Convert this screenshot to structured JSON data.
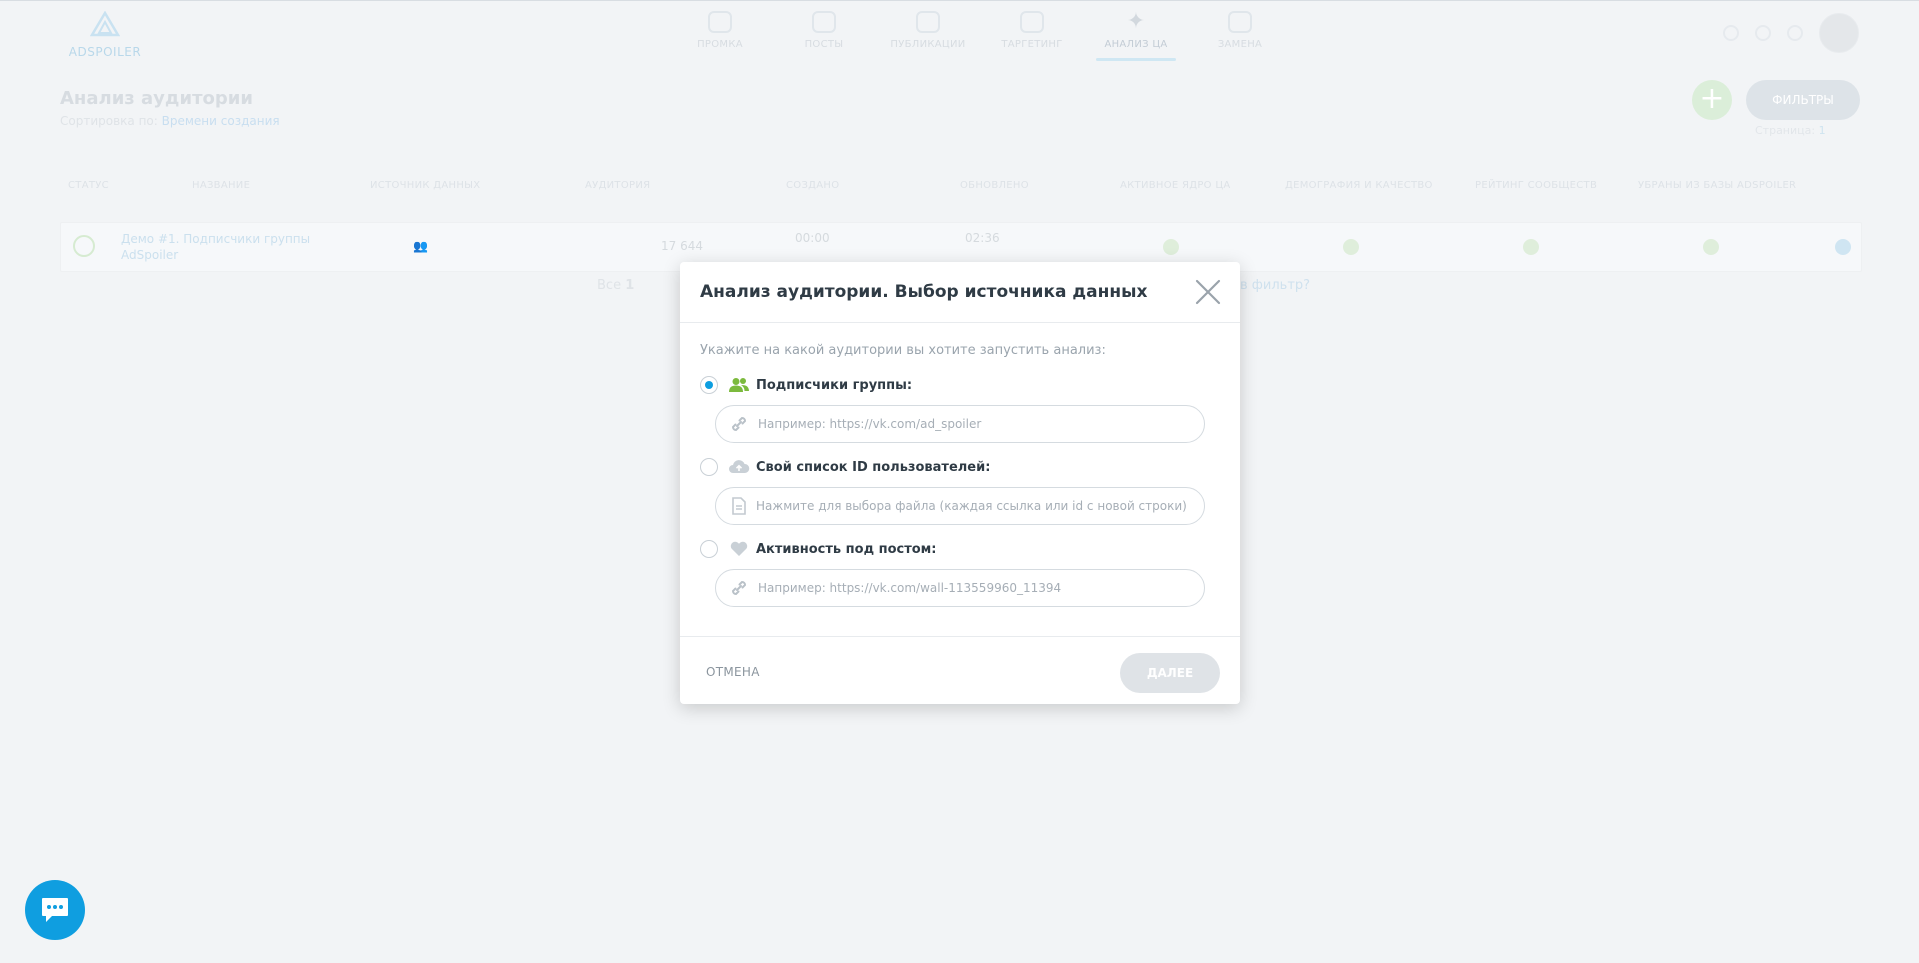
{
  "app": {
    "logo_text": "ADSPOILER",
    "nav": [
      {
        "label": "ПРОМКА"
      },
      {
        "label": "ПОСТЫ"
      },
      {
        "label": "ПУБЛИКАЦИИ"
      },
      {
        "label": "ТАРГЕТИНГ"
      },
      {
        "label": "АНАЛИЗ ЦА"
      },
      {
        "label": "ЗАМЕНА"
      }
    ],
    "active_nav": "АНАЛИЗ ЦА"
  },
  "page": {
    "title": "Анализ аудитории",
    "sort_prefix": "Сортировка по:",
    "sort_value": "Времени создания",
    "filters_button": "ФИЛЬТРЫ",
    "add_button": "+",
    "pages_prefix": "Страница:",
    "pages_value": "1"
  },
  "table": {
    "headers": [
      "СТАТУС",
      "НАЗВАНИЕ",
      "ИСТОЧНИК ДАННЫХ",
      "АУДИТОРИЯ",
      "СОЗДАНО",
      "ОБНОВЛЕНО",
      "АКТИВНОЕ ЯДРО ЦА",
      "ДЕМОГРАФИЯ И КАЧЕСТВО",
      "РЕЙТИНГ СООБЩЕСТВ",
      "УБРАНЫ ИЗ БАЗЫ ADSPOILER"
    ],
    "row": {
      "name_line1": "Демо #1. Подписчики группы",
      "name_line2": "AdSpoiler",
      "audience": "17 644",
      "created_time": "00:00",
      "updated_time": "02:36"
    },
    "footer_prefix": "Все",
    "footer_count": "1",
    "footer_link": "в фильтр?"
  },
  "modal": {
    "title": "Анализ аудитории. Выбор источника данных",
    "prompt": "Укажите на какой аудитории вы хотите запустить анализ:",
    "options": [
      {
        "label": "Подписчики группы:",
        "placeholder": "Например: https://vk.com/ad_spoiler",
        "selected": true,
        "icon": "users-icon"
      },
      {
        "label": "Свой список ID пользователей:",
        "placeholder": "Нажмите для выбора файла (каждая ссылка или id с новой строки)",
        "selected": false,
        "icon": "cloud-upload-icon"
      },
      {
        "label": "Активность под постом:",
        "placeholder": "Например: https://vk.com/wall-113559960_11394",
        "selected": false,
        "icon": "heart-icon"
      }
    ],
    "cancel_label": "ОТМЕНА",
    "next_label": "ДАЛЕЕ"
  },
  "colors": {
    "accent": "#0f9ee0",
    "green": "#7cba3d",
    "title": "#2f3b45"
  }
}
